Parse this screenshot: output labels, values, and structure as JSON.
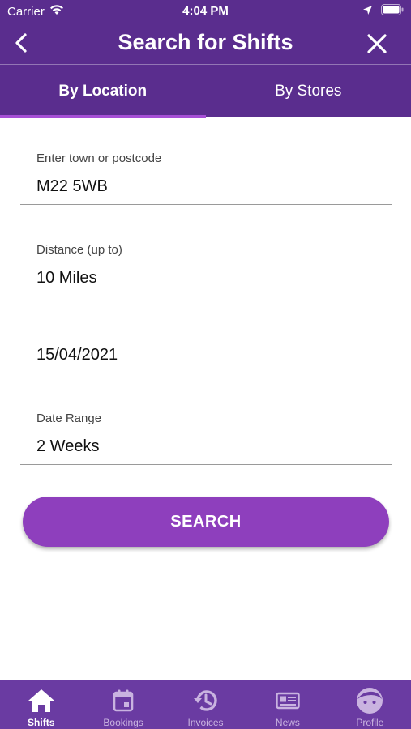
{
  "status_bar": {
    "carrier": "Carrier",
    "time": "4:04 PM"
  },
  "nav": {
    "title": "Search for Shifts"
  },
  "tabs": [
    {
      "label": "By Location",
      "active": true
    },
    {
      "label": "By Stores",
      "active": false
    }
  ],
  "form": {
    "location": {
      "label": "Enter town or postcode",
      "value": "M22 5WB"
    },
    "distance": {
      "label": "Distance (up to)",
      "value": "10 Miles"
    },
    "date": {
      "value": "15/04/2021"
    },
    "date_range": {
      "label": "Date Range",
      "value": "2 Weeks"
    }
  },
  "search_button": {
    "label": "SEARCH"
  },
  "tab_bar": {
    "items": [
      {
        "label": "Shifts",
        "icon": "home-icon",
        "active": true
      },
      {
        "label": "Bookings",
        "icon": "calendar-icon",
        "active": false
      },
      {
        "label": "Invoices",
        "icon": "history-icon",
        "active": false
      },
      {
        "label": "News",
        "icon": "newspaper-icon",
        "active": false
      },
      {
        "label": "Profile",
        "icon": "face-icon",
        "active": false
      }
    ]
  },
  "colors": {
    "header": "#5a2d8e",
    "accent": "#8e3fbd",
    "tab_indicator": "#a64fd6",
    "tab_bar": "#6a3ba2"
  }
}
